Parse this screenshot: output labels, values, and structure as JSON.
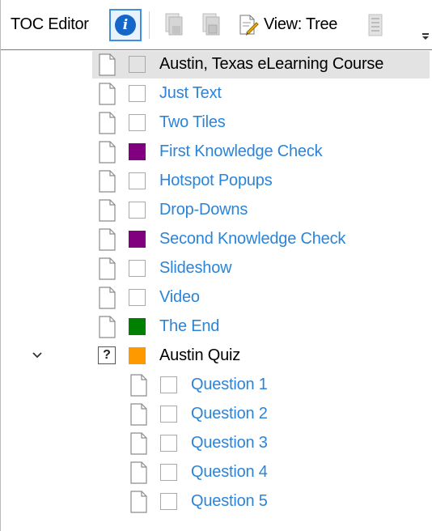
{
  "toolbar": {
    "title": "TOC Editor",
    "info_icon": "info-icon",
    "view_label": "View: Tree"
  },
  "tree": {
    "items": [
      {
        "label": "Austin, Texas eLearning Course",
        "kind": "page",
        "color": "#ffffff",
        "style": "plain",
        "selected": true
      },
      {
        "label": "Just Text",
        "kind": "page",
        "color": "#ffffff",
        "style": "link"
      },
      {
        "label": "Two Tiles",
        "kind": "page",
        "color": "#ffffff",
        "style": "link"
      },
      {
        "label": "First Knowledge Check",
        "kind": "page",
        "color": "#800080",
        "style": "link"
      },
      {
        "label": "Hotspot Popups",
        "kind": "page",
        "color": "#ffffff",
        "style": "link"
      },
      {
        "label": "Drop-Downs",
        "kind": "page",
        "color": "#ffffff",
        "style": "link"
      },
      {
        "label": "Second Knowledge Check",
        "kind": "page",
        "color": "#800080",
        "style": "link"
      },
      {
        "label": "Slideshow",
        "kind": "page",
        "color": "#ffffff",
        "style": "link"
      },
      {
        "label": "Video",
        "kind": "page",
        "color": "#ffffff",
        "style": "link"
      },
      {
        "label": "The End",
        "kind": "page",
        "color": "#008000",
        "style": "link"
      },
      {
        "label": "Austin Quiz",
        "kind": "quiz",
        "color": "#ff9900",
        "style": "plain",
        "expanded": true
      },
      {
        "label": "Question 1",
        "kind": "page",
        "color": "#ffffff",
        "style": "link",
        "child": true
      },
      {
        "label": "Question 2",
        "kind": "page",
        "color": "#ffffff",
        "style": "link",
        "child": true
      },
      {
        "label": "Question 3",
        "kind": "page",
        "color": "#ffffff",
        "style": "link",
        "child": true
      },
      {
        "label": "Question 4",
        "kind": "page",
        "color": "#ffffff",
        "style": "link",
        "child": true
      },
      {
        "label": "Question 5",
        "kind": "page",
        "color": "#ffffff",
        "style": "link",
        "child": true
      }
    ]
  }
}
